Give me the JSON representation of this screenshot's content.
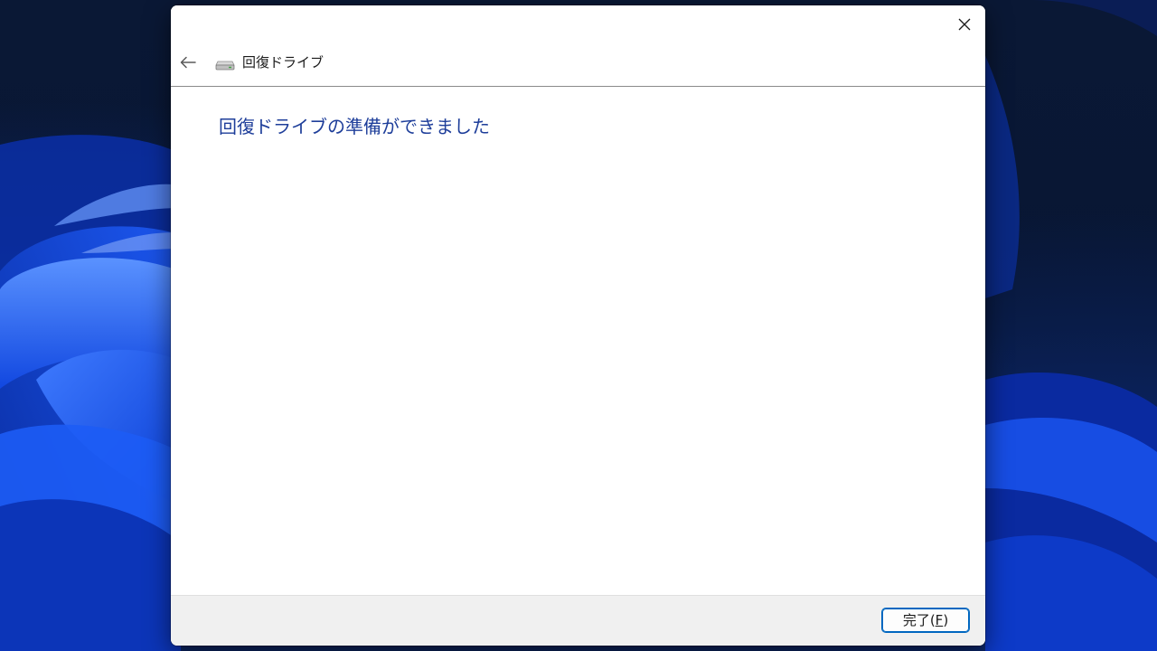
{
  "window": {
    "nav_title": "回復ドライブ",
    "heading": "回復ドライブの準備ができました"
  },
  "footer": {
    "finish_label": "完了(",
    "finish_accel": "F",
    "finish_suffix": ")"
  },
  "icons": {
    "close": "close-icon",
    "back": "back-arrow-icon",
    "drive": "drive-icon"
  },
  "colors": {
    "heading": "#1e3e9a",
    "button_border": "#0067c0",
    "footer_bg": "#f0f0f0"
  }
}
